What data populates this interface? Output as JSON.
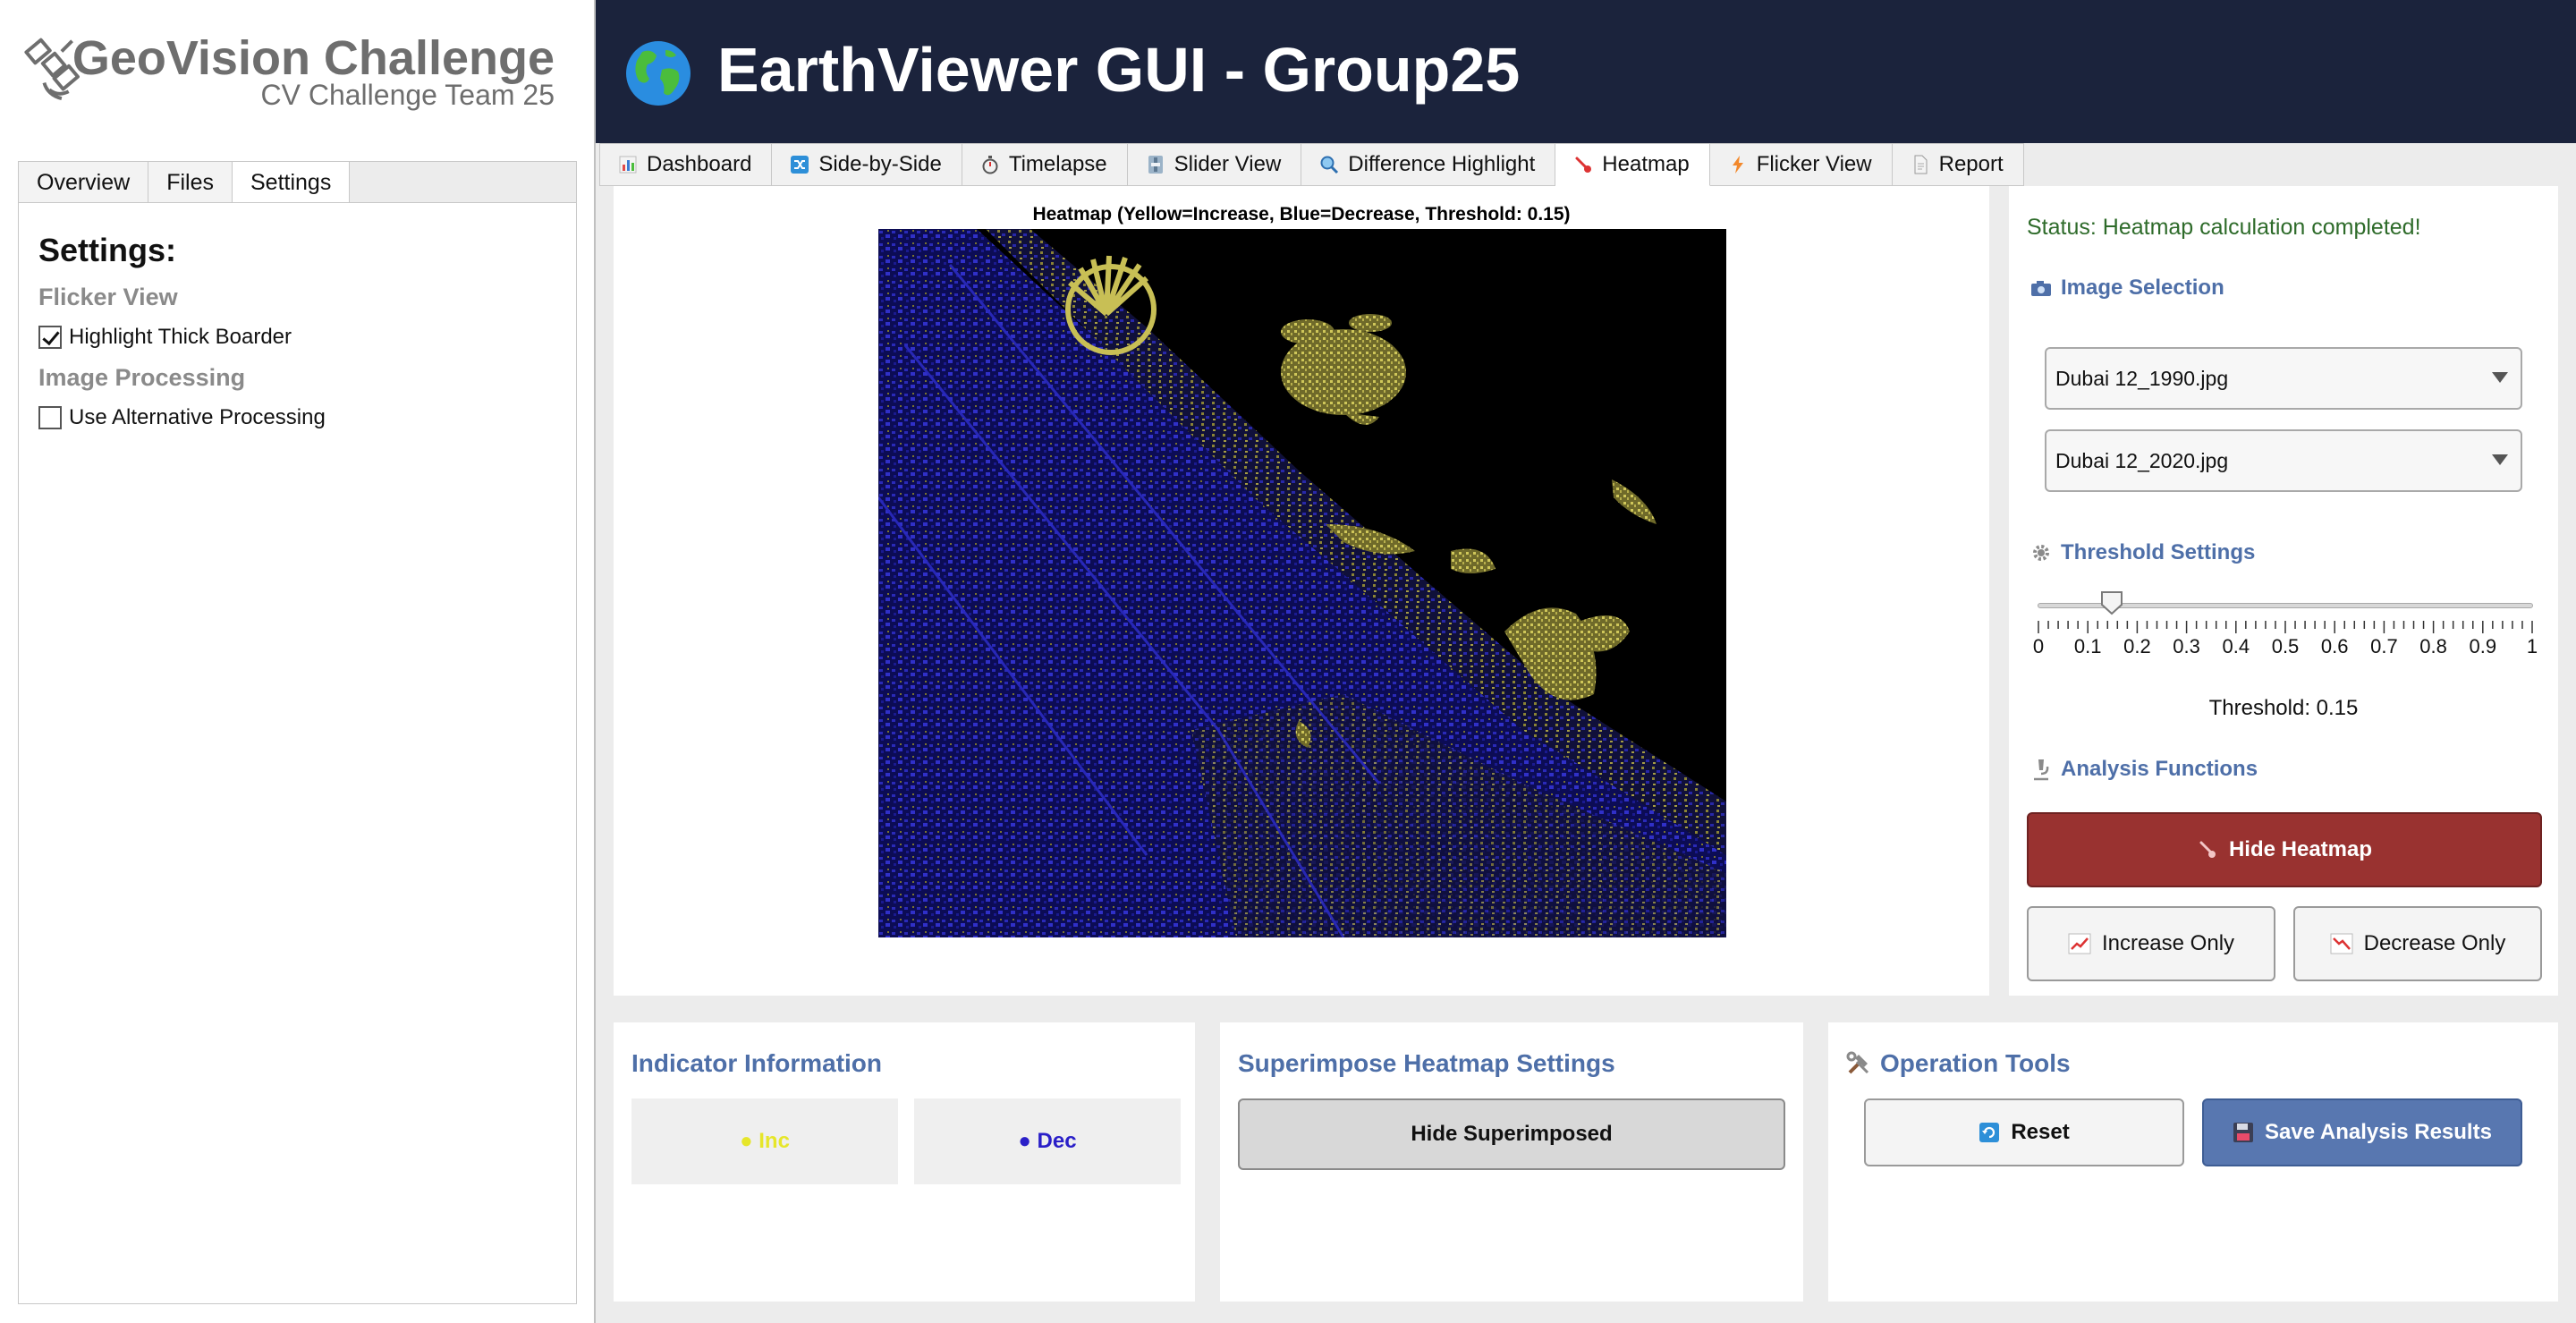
{
  "sidebar": {
    "brand_title": "GeoVision Challenge",
    "brand_subtitle": "CV Challenge Team 25",
    "tabs": [
      "Overview",
      "Files",
      "Settings"
    ],
    "active_tab": "Settings",
    "heading": "Settings:",
    "sections": [
      {
        "title": "Flicker View",
        "option": "Highlight Thick Boarder",
        "checked": true
      },
      {
        "title": "Image Processing",
        "option": "Use Alternative Processing",
        "checked": false
      }
    ]
  },
  "header": {
    "title": "EarthViewer GUI - Group25",
    "icon": "globe-icon"
  },
  "tabs": [
    {
      "label": "Dashboard",
      "icon": "bar-chart-icon"
    },
    {
      "label": "Side-by-Side",
      "icon": "shuffle-icon"
    },
    {
      "label": "Timelapse",
      "icon": "stopwatch-icon"
    },
    {
      "label": "Slider View",
      "icon": "slider-icon"
    },
    {
      "label": "Difference Highlight",
      "icon": "magnifier-icon"
    },
    {
      "label": "Heatmap",
      "icon": "thermometer-icon"
    },
    {
      "label": "Flicker View",
      "icon": "lightning-icon"
    },
    {
      "label": "Report",
      "icon": "document-icon"
    }
  ],
  "active_tab": "Heatmap",
  "heatmap": {
    "caption": "Heatmap (Yellow=Increase, Blue=Decrease, Threshold: 0.15)",
    "increase_color": "#cfc75a",
    "decrease_color": "#2a2ab8"
  },
  "controls": {
    "status": "Status: Heatmap calculation completed!",
    "image_selection_title": "Image Selection",
    "image_a": "Dubai 12_1990.jpg",
    "image_b": "Dubai 12_2020.jpg",
    "threshold_title": "Threshold Settings",
    "threshold_value": 0.15,
    "slider_min": 0,
    "slider_max": 1,
    "tick_labels": [
      "0",
      "0.1",
      "0.2",
      "0.3",
      "0.4",
      "0.5",
      "0.6",
      "0.7",
      "0.8",
      "0.9",
      "1"
    ],
    "threshold_text": "Threshold: 0.15",
    "analysis_title": "Analysis Functions",
    "hide_heatmap": "Hide Heatmap",
    "increase_only": "Increase Only",
    "decrease_only": "Decrease Only"
  },
  "indicator": {
    "title": "Indicator Information",
    "inc": "● Inc",
    "dec": "● Dec",
    "inc_color": "#e6e62a",
    "dec_color": "#2a1fc8"
  },
  "superimpose": {
    "title": "Superimpose Heatmap Settings",
    "button": "Hide Superimposed"
  },
  "operations": {
    "title": "Operation Tools",
    "reset": "Reset",
    "save": "Save Analysis Results"
  },
  "colors": {
    "header_bg": "#1b233c",
    "accent_blue": "#4e6fa8",
    "hide_button": "#993230",
    "status_green": "#2e6b2a"
  }
}
